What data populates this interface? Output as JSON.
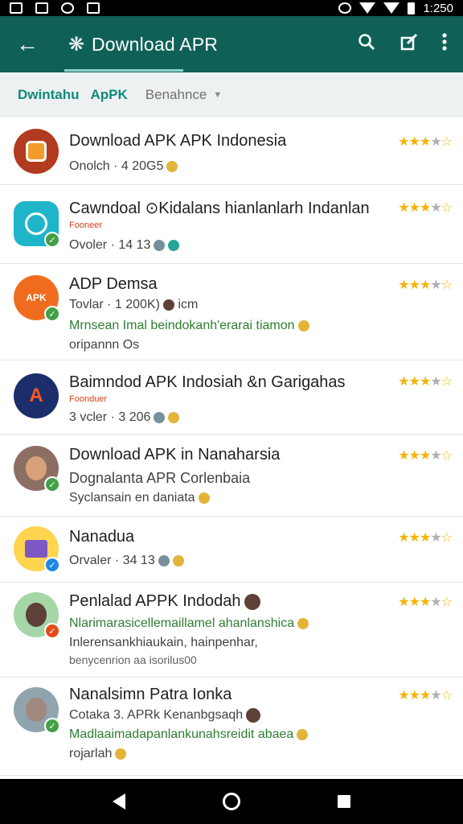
{
  "status": {
    "time": "1:250"
  },
  "app_bar": {
    "title": "Download APR"
  },
  "tabs": {
    "tab1": "Dwintahu",
    "tab2": "ApPK",
    "sort_label": "Benahnce"
  },
  "colors": {
    "primary": "#0f6157",
    "accent": "#108a7d",
    "star": "#f4b400"
  },
  "items": [
    {
      "title": "Download APK APK Indonesia",
      "line1": "Onolch · 4 20G5",
      "rating": 3.5
    },
    {
      "title": "Cawndoal ⊙Kidalans hianlanlarh Indanlan",
      "tag": "Fooneer",
      "line1": "Ovoler · 14 13",
      "rating": 3.5
    },
    {
      "title": "ADP Demsa",
      "line1": "Tovlar · 1 200K)",
      "line1_suffix": "icm",
      "line2": "Mrnsean Imal beindokanh'erarai tiamon",
      "line3": "oripannn Os",
      "rating": 3.5
    },
    {
      "title": "Baimndod APK Indosiah &n Garigahas",
      "tag": "Foonduer",
      "line1": "3 vcler · 3 206",
      "rating": 3.5
    },
    {
      "title": "Download APK in Nanaharsia",
      "line1": "Dognalanta APR Corlenbaia",
      "line2": "Syclansain en daniata",
      "rating": 3.5
    },
    {
      "title": "Nanadua",
      "line1": "Orvaler · 34 13",
      "rating": 3.5
    },
    {
      "title": "Penlalad APPK Indodah",
      "line1": "Nlarimarasicellemaillamel ahanlanshica",
      "line2": "Inlerensankhiaukain, hainpenhar,",
      "line3": "benycenrion aa isorilus00",
      "rating": 3.5
    },
    {
      "title": "Nanalsimn Patra Ionka",
      "line1": "Cotaka 3. APRk Kenanbgsaqh",
      "line2": "Madlaaimadapanlankunahsreidit abaea",
      "line3": "rojarlah",
      "rating": 3.5
    }
  ]
}
